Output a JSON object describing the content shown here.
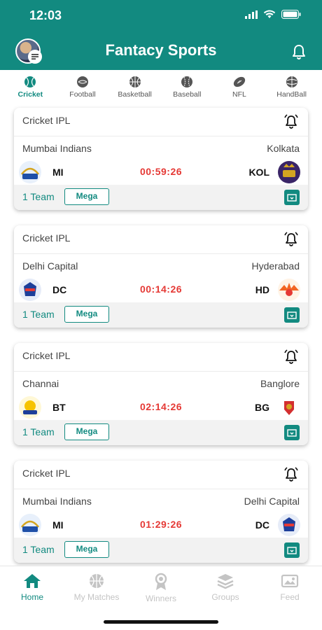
{
  "status_bar": {
    "time": "12:03"
  },
  "header": {
    "title": "Fantacy Sports"
  },
  "sports_tabs": [
    {
      "label": "Cricket",
      "icon": "cricket-ball-icon",
      "active": true
    },
    {
      "label": "Football",
      "icon": "football-icon"
    },
    {
      "label": "Basketball",
      "icon": "basketball-icon"
    },
    {
      "label": "Baseball",
      "icon": "baseball-icon"
    },
    {
      "label": "NFL",
      "icon": "american-football-icon"
    },
    {
      "label": "HandBall",
      "icon": "handball-icon"
    }
  ],
  "matches": [
    {
      "league": "Cricket IPL",
      "left_team": "Mumbai Indians",
      "left_abbr": "MI",
      "right_team": "Kolkata",
      "right_abbr": "KOL",
      "time": "00:59:26",
      "team_count": "1 Team",
      "badge": "Mega"
    },
    {
      "league": "Cricket IPL",
      "left_team": "Delhi Capital",
      "left_abbr": "DC",
      "right_team": "Hyderabad",
      "right_abbr": "HD",
      "time": "00:14:26",
      "team_count": "1 Team",
      "badge": "Mega"
    },
    {
      "league": "Cricket IPL",
      "left_team": "Channai",
      "left_abbr": "BT",
      "right_team": "Banglore",
      "right_abbr": "BG",
      "time": "02:14:26",
      "team_count": "1 Team",
      "badge": "Mega"
    },
    {
      "league": "Cricket IPL",
      "left_team": "Mumbai Indians",
      "left_abbr": "MI",
      "right_team": "Delhi Capital",
      "right_abbr": "DC",
      "time": "01:29:26",
      "team_count": "1 Team",
      "badge": "Mega"
    }
  ],
  "bottom_nav": [
    {
      "label": "Home",
      "icon": "home-icon",
      "active": true
    },
    {
      "label": "My Matches",
      "icon": "basketball-icon"
    },
    {
      "label": "Winners",
      "icon": "award-icon"
    },
    {
      "label": "Groups",
      "icon": "layers-icon"
    },
    {
      "label": "Feed",
      "icon": "image-icon"
    }
  ],
  "colors": {
    "primary": "#128a80",
    "timer": "#e53935",
    "nav_inactive": "#c4c4c4"
  }
}
